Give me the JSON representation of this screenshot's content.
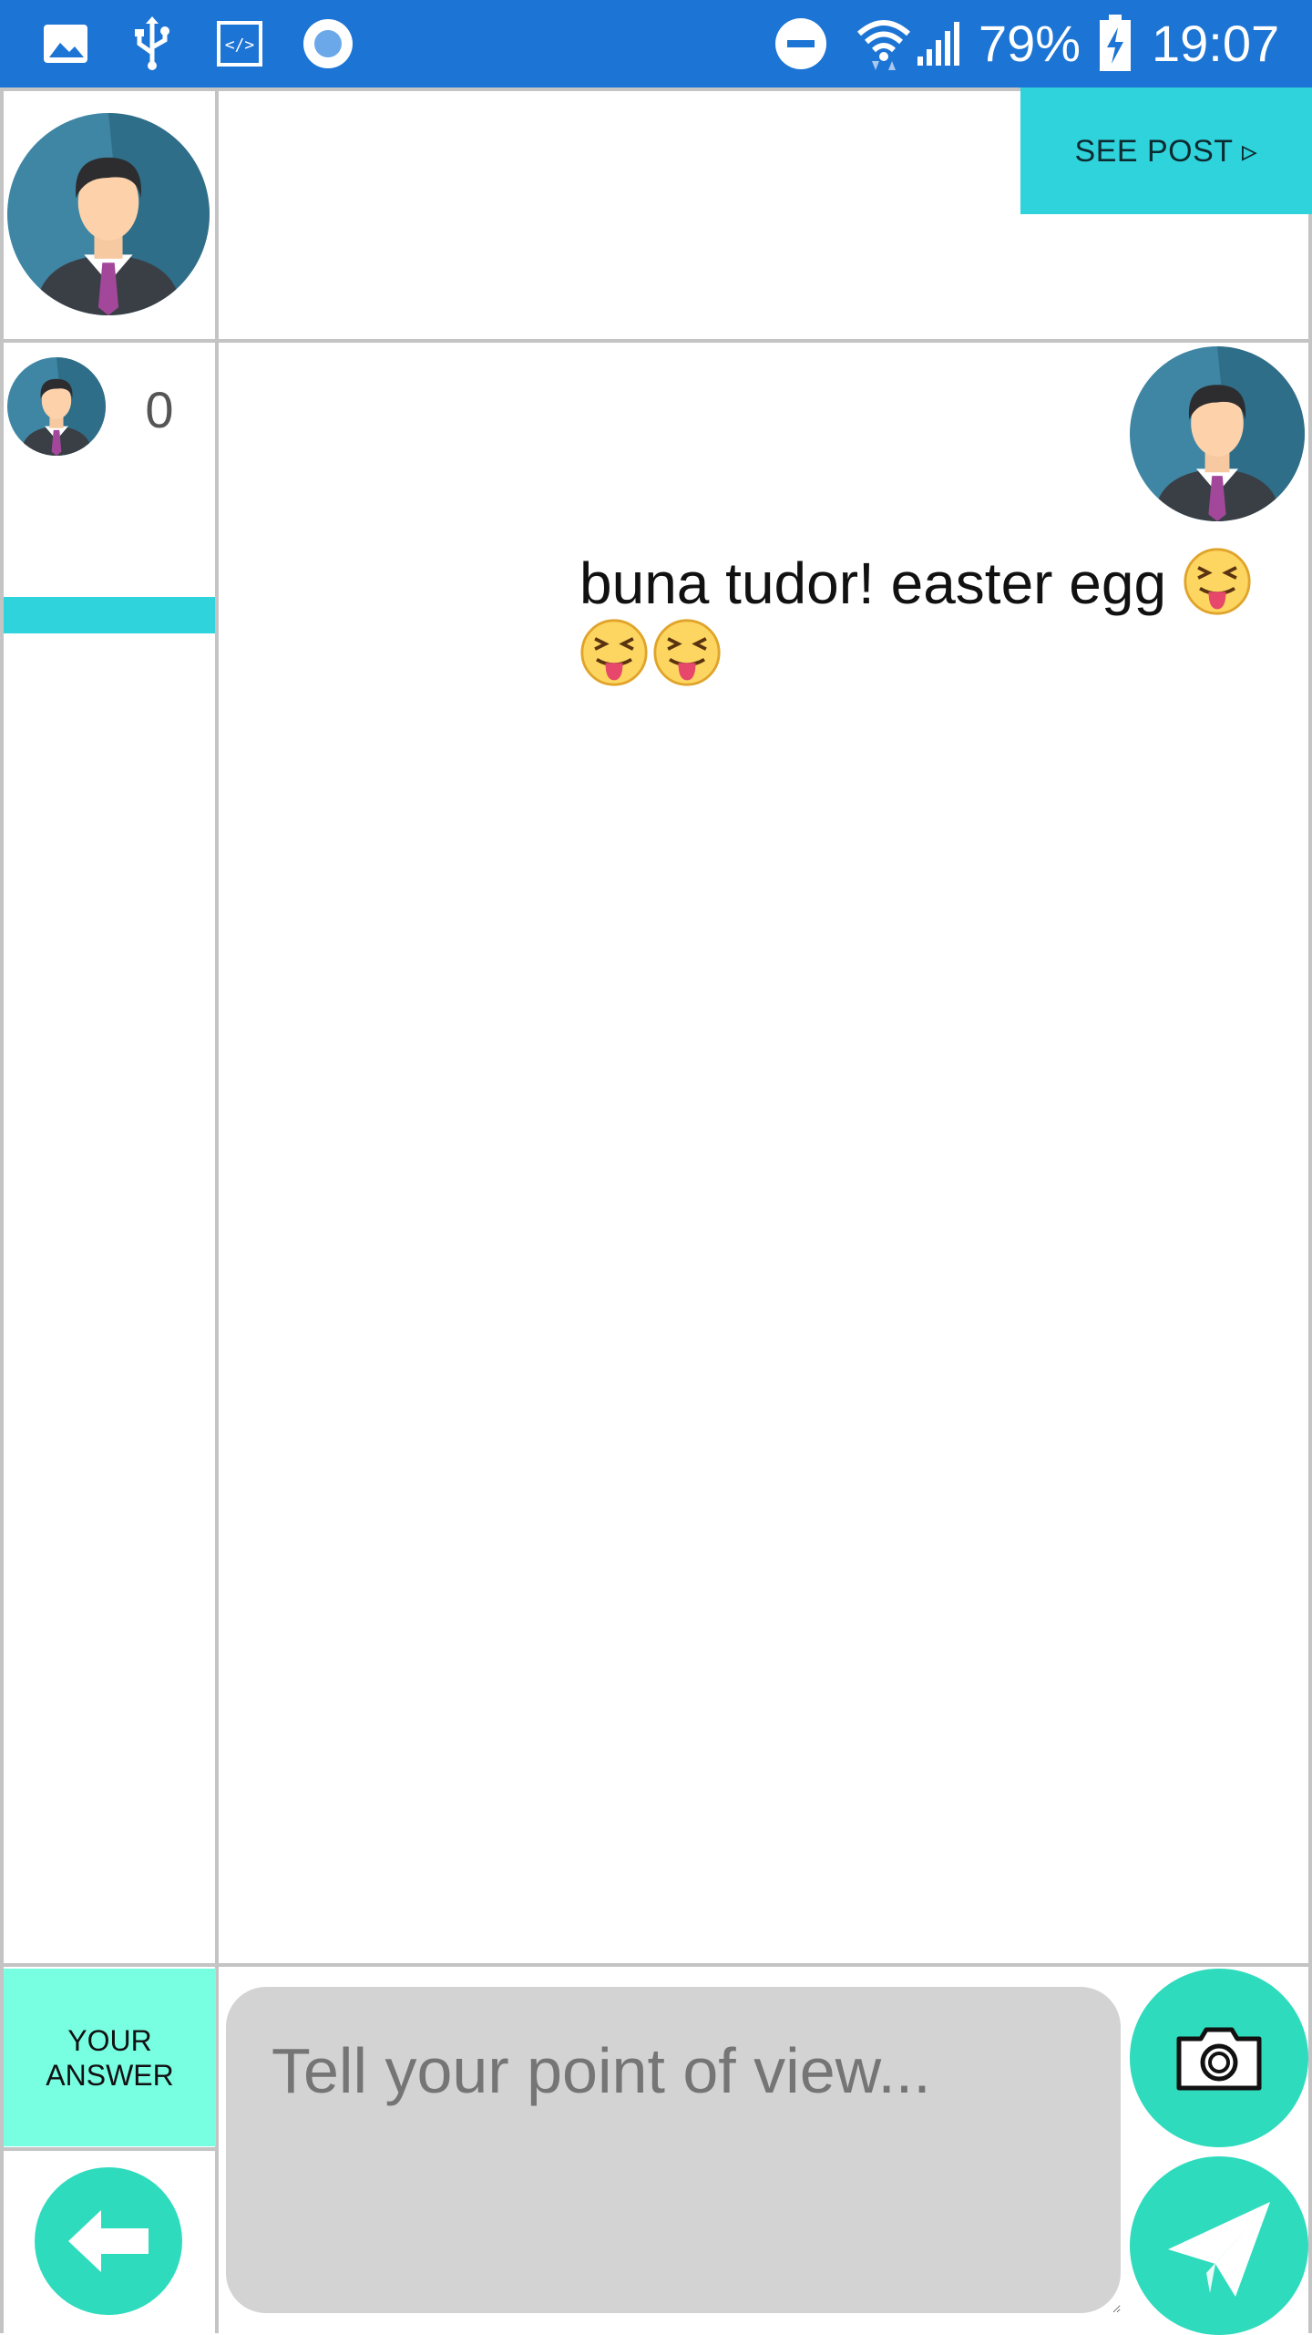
{
  "status_bar": {
    "battery": "79%",
    "time": "19:07",
    "icons": [
      "image-icon",
      "usb-icon",
      "code-icon",
      "record-icon",
      "do-not-disturb-icon",
      "wifi-icon",
      "signal-icon",
      "battery-charging-icon"
    ]
  },
  "post": {
    "see_post_label": "SEE POST ▹"
  },
  "sidebar": {
    "count": "0",
    "progress": 1.0
  },
  "message": {
    "text": "buna tudor! easter egg",
    "emojis": [
      "squinting-face-with-tongue",
      "squinting-face-with-tongue",
      "squinting-face-with-tongue"
    ]
  },
  "composer": {
    "your_answer_line1": "YOUR",
    "your_answer_line2": "ANSWER",
    "placeholder": "Tell your point of view..."
  },
  "colors": {
    "status_bar": "#1c74d4",
    "accent_cyan": "#2fd3dc",
    "accent_mint": "#78ffe2",
    "button_teal": "#2fdbbd",
    "input_grey": "#d3d3d3"
  }
}
